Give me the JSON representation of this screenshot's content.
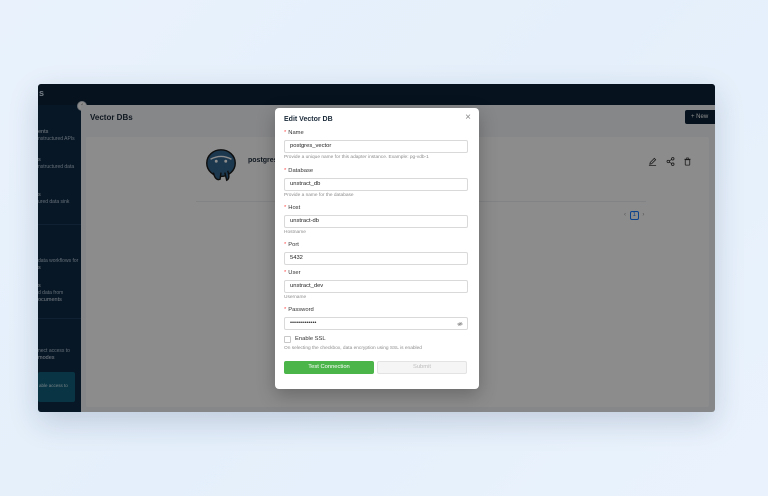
{
  "topbar": {
    "logo_fragment": "s"
  },
  "sidebar": {
    "items": [
      {
        "title": "ents",
        "desc": "nstructured APIs"
      },
      {
        "title": "s",
        "desc": "nstructured data"
      },
      {
        "title": "s",
        "desc": "ured data sink"
      },
      {
        "title": "",
        "desc": "data workflows for"
      },
      {
        "title": "",
        "desc": "s"
      },
      {
        "title": "s",
        "desc": "d data from"
      },
      {
        "title": "",
        "desc": "ocuments"
      },
      {
        "title": "",
        "desc": "nect access to"
      },
      {
        "title": "",
        "desc": "modes"
      }
    ],
    "card_text": "able access to"
  },
  "collapse_glyph": "‹",
  "header": {
    "title": "Vector DBs",
    "new_button": "+ New"
  },
  "adapter": {
    "name": "postgres"
  },
  "pagination": {
    "prev": "‹",
    "current": "1",
    "next": "›"
  },
  "modal": {
    "title": "Edit Vector DB",
    "close_glyph": "×",
    "required_mark": "*",
    "fields": {
      "name": {
        "label": "Name",
        "value": "postgres_vector",
        "help": "Provide a unique name for this adapter instance. Example: pg-vdb-1"
      },
      "database": {
        "label": "Database",
        "value": "unstract_db",
        "help": "Provide a name for the database"
      },
      "host": {
        "label": "Host",
        "value": "unstract-db",
        "help": "Hostname"
      },
      "port": {
        "label": "Port",
        "value": "5432"
      },
      "user": {
        "label": "User",
        "value": "unstract_dev",
        "help": "Username"
      },
      "password": {
        "label": "Password",
        "value": "•••••••••••••"
      }
    },
    "ssl": {
      "label": "Enable SSL",
      "help": "On selecting the checkbox, data encryption using SSL is enabled"
    },
    "buttons": {
      "test": "Test Connection",
      "submit": "Submit"
    }
  },
  "colors": {
    "topbar": "#0c2338",
    "sidebar": "#0d2a45",
    "primary_green": "#4cb54a",
    "required": "#ff4d4f",
    "link_blue": "#1677ff"
  }
}
